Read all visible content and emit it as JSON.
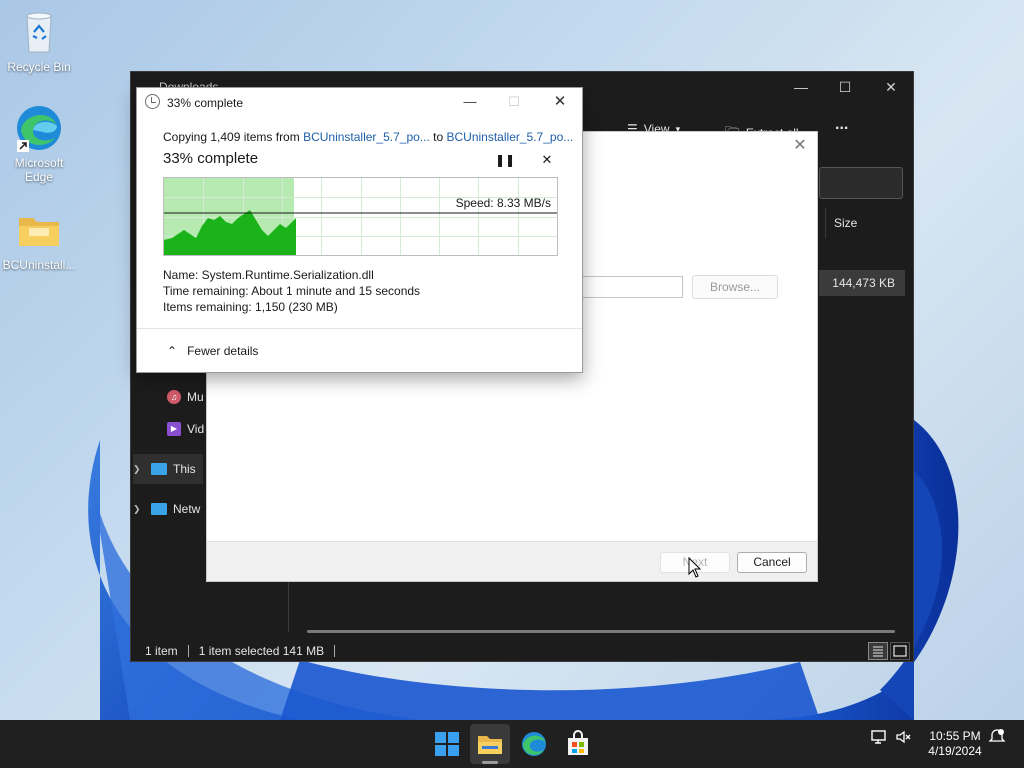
{
  "desktop": {
    "icons": [
      {
        "label": "Recycle Bin",
        "icon": "recycle-bin-icon"
      },
      {
        "label": "Microsoft Edge",
        "icon": "edge-icon"
      },
      {
        "label": "BCUninstall...",
        "icon": "folder-icon"
      }
    ]
  },
  "explorer": {
    "title": "Downloads",
    "toolbar": {
      "view_label": "View",
      "extract_label": "Extract all",
      "more_label": "..."
    },
    "column_size": "Size",
    "file_size": "144,473 KB",
    "nav": [
      {
        "label": "Mu",
        "icon": "music-icon"
      },
      {
        "label": "Vid",
        "icon": "videos-icon"
      },
      {
        "label": "This",
        "icon": "this-pc-icon"
      },
      {
        "label": "Netw",
        "icon": "network-icon"
      }
    ],
    "status": {
      "count": "1 item",
      "selected": "1 item selected  141 MB"
    }
  },
  "wizard": {
    "browse_label": "Browse...",
    "next_label": "Next",
    "cancel_label": "Cancel"
  },
  "copy_dialog": {
    "title": "33% complete",
    "line_prefix": "Copying 1,409 items from ",
    "source": "BCUninstaller_5.7_po...",
    "line_mid": " to ",
    "destination": "BCUninstaller_5.7_po...",
    "heading": "33% complete",
    "progress_fraction": 0.33,
    "speed": "Speed: 8.33 MB/s",
    "name_line": "Name:  System.Runtime.Serialization.dll",
    "time_line": "Time remaining:  About 1 minute and 15 seconds",
    "items_line": "Items remaining:  1,150 (230 MB)",
    "fewer_details": "Fewer details"
  },
  "taskbar": {
    "time": "10:55 PM",
    "date": "4/19/2024"
  },
  "colors": {
    "accent": "#0067c0",
    "progress_fill": "#b6eab0",
    "graph_fill": "#1ab31a",
    "explorer_bg": "#1c1c1c",
    "taskbar_bg": "#202020"
  }
}
